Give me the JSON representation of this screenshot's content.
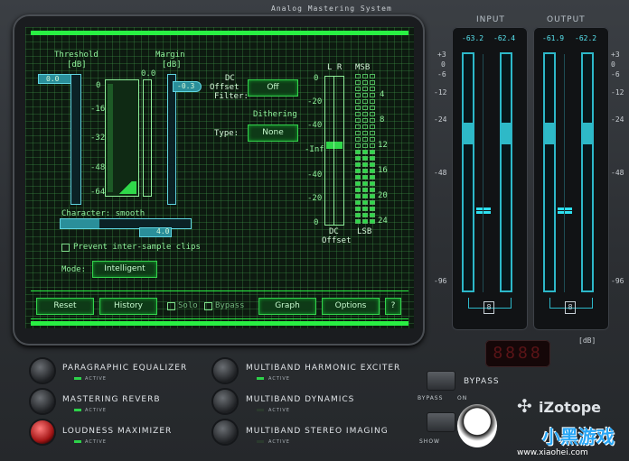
{
  "app": {
    "title": "Analog Mastering System",
    "logo": "iZotope"
  },
  "threshold": {
    "label": "Threshold",
    "unit": "[dB]",
    "value": "0.0",
    "scale": [
      "0",
      "-16",
      "-32",
      "-48",
      "-64"
    ]
  },
  "margin": {
    "label": "Margin",
    "unit": "[dB]",
    "top": "0.0",
    "value": "-0.3"
  },
  "dc_offset_filter": {
    "label_1": "DC",
    "label_2": "Offset",
    "label_3": "Filter:",
    "value": "Off"
  },
  "dithering": {
    "label": "Dithering",
    "type_label": "Type:",
    "value": "None"
  },
  "offset_meter": {
    "lr": "L R",
    "msb": "MSB",
    "lsb": "LSB",
    "scale": [
      "0",
      "-20",
      "-40",
      "-Inf",
      "-40",
      "-20",
      "0"
    ],
    "bits": [
      "4",
      "8",
      "12",
      "16",
      "20",
      "24"
    ],
    "label_1": "DC",
    "label_2": "Offset"
  },
  "character": {
    "label": "Character: smooth",
    "value": "4.0",
    "fill": 0.3
  },
  "intersample": {
    "label": "Prevent inter-sample clips",
    "checked": false
  },
  "mode": {
    "label": "Mode:",
    "value": "Intelligent"
  },
  "bottom_bar": {
    "reset": "Reset",
    "history": "History",
    "solo": "Solo",
    "bypass": "Bypass",
    "graph": "Graph",
    "options": "Options",
    "help": "?"
  },
  "input_meter": {
    "title": "INPUT",
    "left": "-63.2",
    "right": "-62.4",
    "link_icon": "link-icon"
  },
  "output_meter": {
    "title": "OUTPUT",
    "left": "-61.9",
    "right": "-62.2",
    "link_icon": "link-icon"
  },
  "meter_scale": [
    "+3",
    "0",
    "-6",
    "-12",
    "-24",
    "-48",
    "-96"
  ],
  "db_label": "[dB]",
  "display_digits": "8888",
  "modules": [
    {
      "name": "PARAGRAPHIC EQUALIZER",
      "status": "ACTIVE",
      "led_on": true,
      "knob": "grey"
    },
    {
      "name": "MASTERING REVERB",
      "status": "ACTIVE",
      "led_on": true,
      "knob": "grey"
    },
    {
      "name": "LOUDNESS MAXIMIZER",
      "status": "ACTIVE",
      "led_on": true,
      "knob": "red"
    },
    {
      "name": "MULTIBAND HARMONIC EXCITER",
      "status": "ACTIVE",
      "led_on": true,
      "knob": "grey"
    },
    {
      "name": "MULTIBAND DYNAMICS",
      "status": "ACTIVE",
      "led_on": false,
      "knob": "grey"
    },
    {
      "name": "MULTIBAND STEREO IMAGING",
      "status": "ACTIVE",
      "led_on": false,
      "knob": "grey"
    }
  ],
  "bypass": {
    "label": "BYPASS",
    "sub_1": "BYPASS",
    "sub_2": "ON"
  },
  "show": {
    "label": "SHOW"
  },
  "watermark": {
    "text": "小黑游戏",
    "url": "www.xiaohei.com"
  },
  "colors": {
    "screen_green": "#29f043",
    "meter_cyan": "#2db8c9",
    "active_led": "#2dd24a",
    "knob_red": "#c21b1b"
  }
}
